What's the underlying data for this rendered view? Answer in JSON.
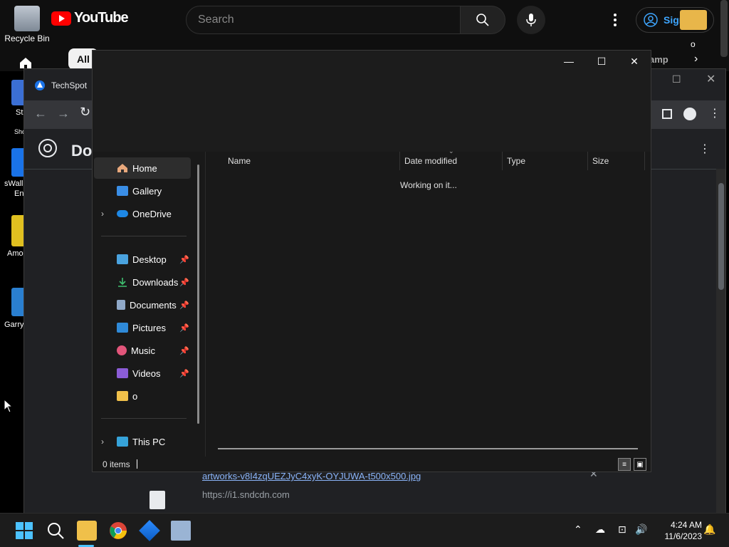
{
  "desktop": {
    "recycle_bin_label": "Recycle Bin",
    "partial_labels": [
      "Sti",
      "Sho",
      "sWall",
      "En",
      "Amo",
      "Garry"
    ]
  },
  "youtube": {
    "logo_text": "YouTube",
    "search_placeholder": "Search",
    "signin_label": "Sign in",
    "chip_all": "All",
    "chip_partial": "amp",
    "corner_text": "o"
  },
  "chrome": {
    "tab_title": "TechSpot",
    "page_title_partial": "Do",
    "download_file": "artworks-v8I4zqUEZJyC4xyK-OYJUWA-t500x500.jpg",
    "download_url": "https://i1.sndcdn.com"
  },
  "explorer": {
    "window_controls": {
      "minimize": "—",
      "maximize": "☐",
      "close": "✕"
    },
    "nav": {
      "top": [
        {
          "label": "Home",
          "icon": "home-icon",
          "selected": true
        },
        {
          "label": "Gallery",
          "icon": "gallery-icon"
        },
        {
          "label": "OneDrive",
          "icon": "cloud-icon",
          "expandable": true
        }
      ],
      "pinned": [
        {
          "label": "Desktop",
          "icon": "desktop-icon",
          "pinned": true
        },
        {
          "label": "Downloads",
          "icon": "download-icon",
          "pinned": true
        },
        {
          "label": "Documents",
          "icon": "document-icon",
          "pinned": true
        },
        {
          "label": "Pictures",
          "icon": "pictures-icon",
          "pinned": true
        },
        {
          "label": "Music",
          "icon": "music-icon",
          "pinned": true
        },
        {
          "label": "Videos",
          "icon": "videos-icon",
          "pinned": true
        },
        {
          "label": "o",
          "icon": "folder-icon",
          "pinned": false
        }
      ],
      "bottom": [
        {
          "label": "This PC",
          "icon": "computer-icon",
          "expandable": true
        }
      ]
    },
    "columns": [
      "Name",
      "Date modified",
      "Type",
      "Size"
    ],
    "loading_text": "Working on it...",
    "status_text": "0 items"
  },
  "taskbar": {
    "time": "4:24 AM",
    "date": "11/6/2023"
  },
  "colors": {
    "youtube_red": "#ff0000",
    "explorer_bg": "#191919",
    "selected_nav": "#2d2d2d",
    "chrome_link": "#8ab4f8"
  }
}
